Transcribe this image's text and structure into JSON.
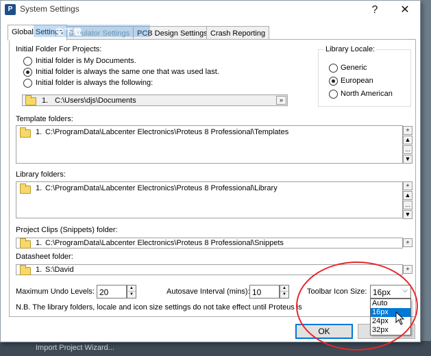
{
  "window": {
    "title": "System Settings",
    "help_label": "?",
    "close_label": "✕"
  },
  "background": {
    "strip_text": "Import Project Wizard..."
  },
  "watermark": {
    "text": "安下载"
  },
  "tabs": [
    {
      "label": "Global Settings"
    },
    {
      "label": "Simulator Settings"
    },
    {
      "label": "PCB Design Settings"
    },
    {
      "label": "Crash Reporting"
    }
  ],
  "initial_folder": {
    "label": "Initial Folder For Projects:",
    "options": [
      {
        "label": "Initial folder is My Documents."
      },
      {
        "label": "Initial folder is always the same one that was used last."
      },
      {
        "label": "Initial folder is always the following:"
      }
    ],
    "selected_index": 1,
    "path_index": "1.",
    "path_value": "C:\\Users\\djs\\Documents",
    "browse_label": "»"
  },
  "library_locale": {
    "label": "Library Locale:",
    "options": [
      {
        "label": "Generic"
      },
      {
        "label": "European"
      },
      {
        "label": "North American"
      }
    ],
    "selected_index": 1
  },
  "template_folders": {
    "label": "Template folders:",
    "items": [
      {
        "index": "1.",
        "path": "C:\\ProgramData\\Labcenter Electronics\\Proteus 8 Professional\\Templates"
      }
    ]
  },
  "library_folders": {
    "label": "Library folders:",
    "items": [
      {
        "index": "1.",
        "path": "C:\\ProgramData\\Labcenter Electronics\\Proteus 8 Professional\\Library"
      }
    ]
  },
  "clips_folder": {
    "label": "Project Clips (Snippets) folder:",
    "items": [
      {
        "index": "1.",
        "path": "C:\\ProgramData\\Labcenter Electronics\\Proteus 8 Professional\\Snippets"
      }
    ]
  },
  "datasheet_folder": {
    "label": "Datasheet folder:",
    "items": [
      {
        "index": "1.",
        "path": "S:\\David"
      }
    ]
  },
  "list_buttons": {
    "add": "+",
    "up": "▲",
    "more": "...",
    "down": "▼"
  },
  "undo": {
    "label": "Maximum Undo Levels:",
    "value": "20"
  },
  "autosave": {
    "label": "Autosave Interval (mins):",
    "value": "10"
  },
  "toolbar_icon": {
    "label": "Toolbar Icon Size:",
    "value": "16px",
    "options": [
      "Auto",
      "16px",
      "24px",
      "32px"
    ],
    "highlighted_index": 1
  },
  "note": "N.B. The library folders, locale and icon size settings do not take effect until Proteus is res",
  "buttons": {
    "ok": "OK",
    "cancel": ""
  },
  "colors": {
    "accent": "#0078d7",
    "annotation": "#e8262a",
    "folder": "#f6d86b"
  }
}
